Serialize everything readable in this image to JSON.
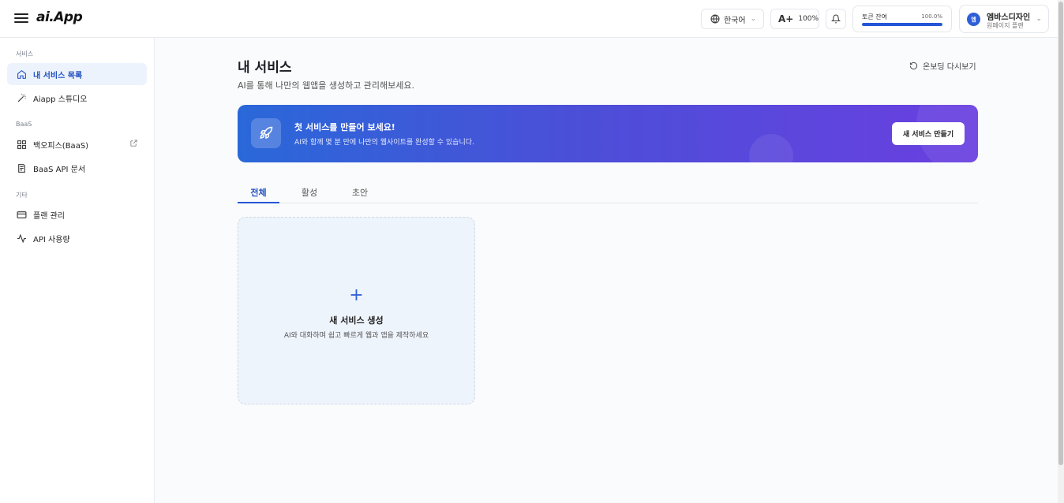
{
  "header": {
    "logo": "ai.App",
    "language_label": "한국어",
    "font_size_label": "100%",
    "font_icon_text": "A+",
    "token": {
      "label": "토큰 잔여",
      "value_text": "100.0%",
      "fill_fraction": 1.0
    },
    "user": {
      "avatar_text": "엠",
      "name": "엠바스디자인",
      "plan": "원페이지 플랜"
    }
  },
  "sidebar": {
    "sections": [
      {
        "label": "서비스",
        "items": [
          {
            "label": "내 서비스 목록",
            "icon": "home-icon",
            "active": true
          },
          {
            "label": "Aiapp 스튜디오",
            "icon": "magic-wand-icon",
            "active": false
          }
        ]
      },
      {
        "label": "BaaS",
        "items": [
          {
            "label": "백오피스(BaaS)",
            "icon": "grid-icon",
            "active": false,
            "external": true
          },
          {
            "label": "BaaS API 문서",
            "icon": "document-icon",
            "active": false
          }
        ]
      },
      {
        "label": "기타",
        "items": [
          {
            "label": "플랜 관리",
            "icon": "card-icon",
            "active": false
          },
          {
            "label": "API 사용량",
            "icon": "activity-icon",
            "active": false
          }
        ]
      }
    ]
  },
  "main": {
    "title": "내 서비스",
    "subtitle": "AI를 통해 나만의 웹앱을 생성하고 관리해보세요.",
    "onboarding_label": "온보딩 다시보기",
    "banner": {
      "title": "첫 서비스를 만들어 보세요!",
      "subtitle": "AI와 함께 몇 분 만에 나만의 웹사이트를 완성할 수 있습니다.",
      "button_label": "새 서비스 만들기"
    },
    "tabs": [
      {
        "label": "전체",
        "active": true
      },
      {
        "label": "활성",
        "active": false
      },
      {
        "label": "초안",
        "active": false
      }
    ],
    "new_card": {
      "plus": "+",
      "title": "새 서비스 생성",
      "subtitle": "AI와 대화하며 쉽고 빠르게 웹과 앱을 제작하세요"
    }
  },
  "colors": {
    "accent": "#2456d6",
    "banner_start": "#2a68d9",
    "banner_end": "#6a3fe0"
  }
}
